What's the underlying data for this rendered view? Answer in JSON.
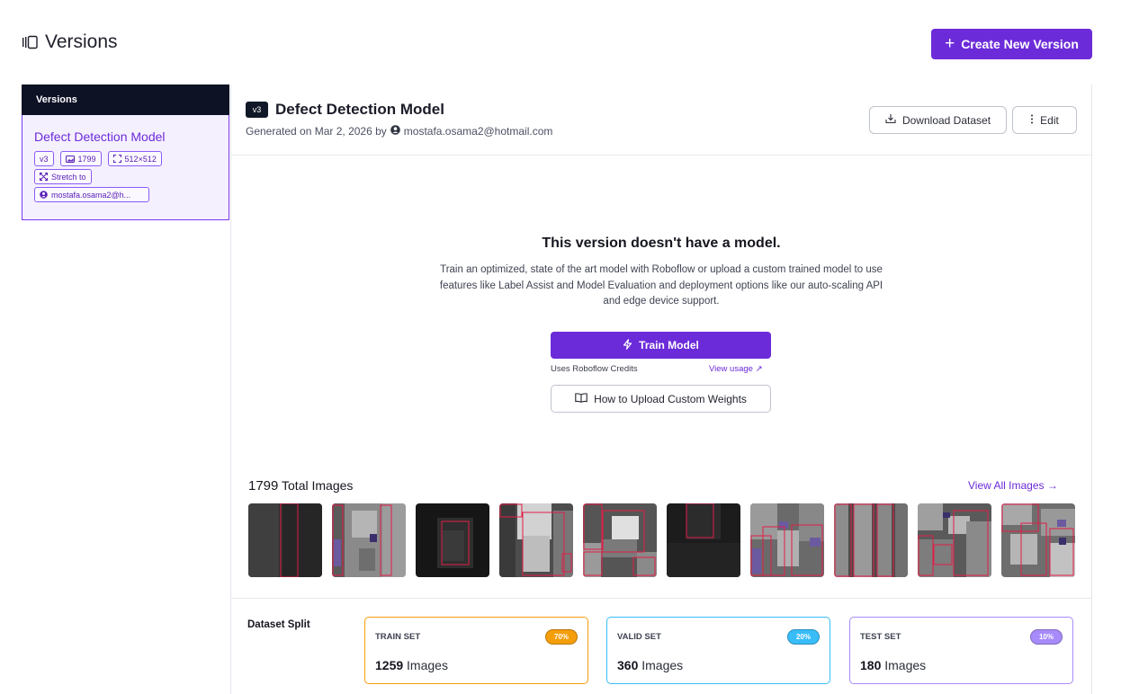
{
  "header": {
    "title": "Versions",
    "create_button": "Create New Version",
    "create_plus": "+"
  },
  "sidebar": {
    "header": "Versions",
    "card": {
      "title": "Defect Detection Model",
      "version": "v3",
      "images": "1799",
      "size": "512×512",
      "resize": "Stretch to",
      "user": "mostafa.osama2@h..."
    }
  },
  "main": {
    "version_badge": "v3",
    "title": "Defect Detection Model",
    "generated": "Generated on Mar 2, 2026 by",
    "generated_user": "mostafa.osama2@hotmail.com",
    "download_button": "Download Dataset",
    "edit_button": "Edit",
    "empty": {
      "title": "This version doesn't have a model.",
      "description": "Train an optimized, state of the art model with Roboflow or upload a custom trained model to use features like Label Assist and Model Evaluation and deployment options like our auto-scaling API and edge device support.",
      "train_button": "Train Model",
      "credits_note": "Uses Roboflow Credits",
      "view_usage": "View usage ↗",
      "upload_button": "How to Upload Custom Weights"
    },
    "images": {
      "count": "1799",
      "label": "Total Images",
      "view_all": "View All Images →"
    },
    "split": {
      "label": "Dataset Split",
      "sets": [
        {
          "name": "TRAIN SET",
          "pct": "70%",
          "count": "1259",
          "unit": "Images",
          "color": "#f59e0b"
        },
        {
          "name": "VALID SET",
          "pct": "20%",
          "count": "360",
          "unit": "Images",
          "color": "#38bdf8"
        },
        {
          "name": "TEST SET",
          "pct": "10%",
          "count": "180",
          "unit": "Images",
          "color": "#a78bfa"
        }
      ]
    }
  },
  "colors": {
    "accent": "#6c2bd9",
    "sidebar_header": "#0e1225",
    "sidebar_card": "#f4f0fe",
    "annotation_box": "#e11d48"
  }
}
